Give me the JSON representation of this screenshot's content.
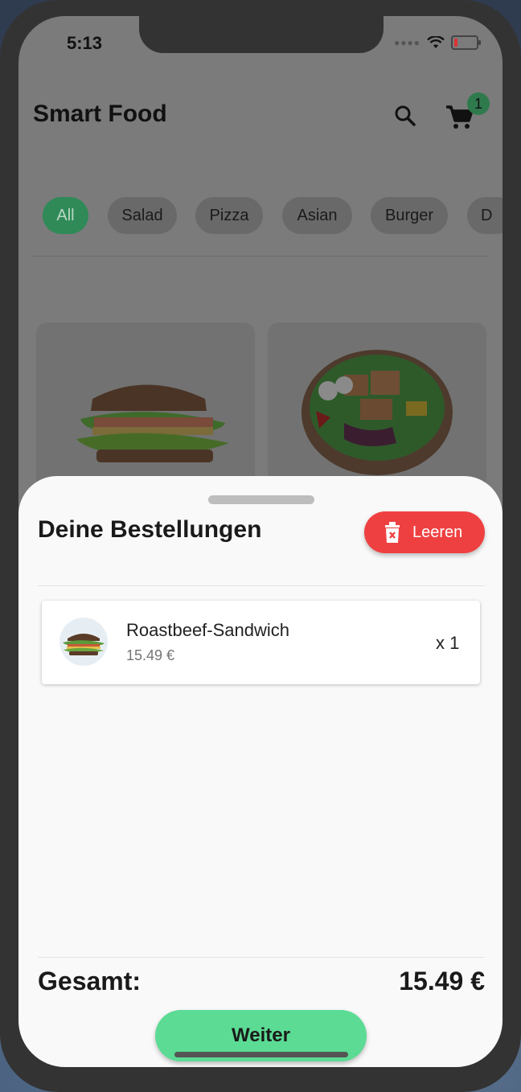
{
  "status_bar": {
    "time": "5:13"
  },
  "header": {
    "title": "Smart Food",
    "cart_count": "1"
  },
  "categories": [
    {
      "label": "All",
      "active": true
    },
    {
      "label": "Salad"
    },
    {
      "label": "Pizza"
    },
    {
      "label": "Asian"
    },
    {
      "label": "Burger"
    },
    {
      "label": "D"
    }
  ],
  "sheet": {
    "title": "Deine Bestellungen",
    "clear_label": "Leeren",
    "items": [
      {
        "name": "Roastbeef-Sandwich",
        "price": "15.49 €",
        "qty": "x 1"
      }
    ],
    "total_label": "Gesamt:",
    "total_value": "15.49 €",
    "next_label": "Weiter"
  },
  "colors": {
    "accent": "#5bdb94",
    "danger": "#ef4041",
    "badge": "#2f7a4d"
  }
}
